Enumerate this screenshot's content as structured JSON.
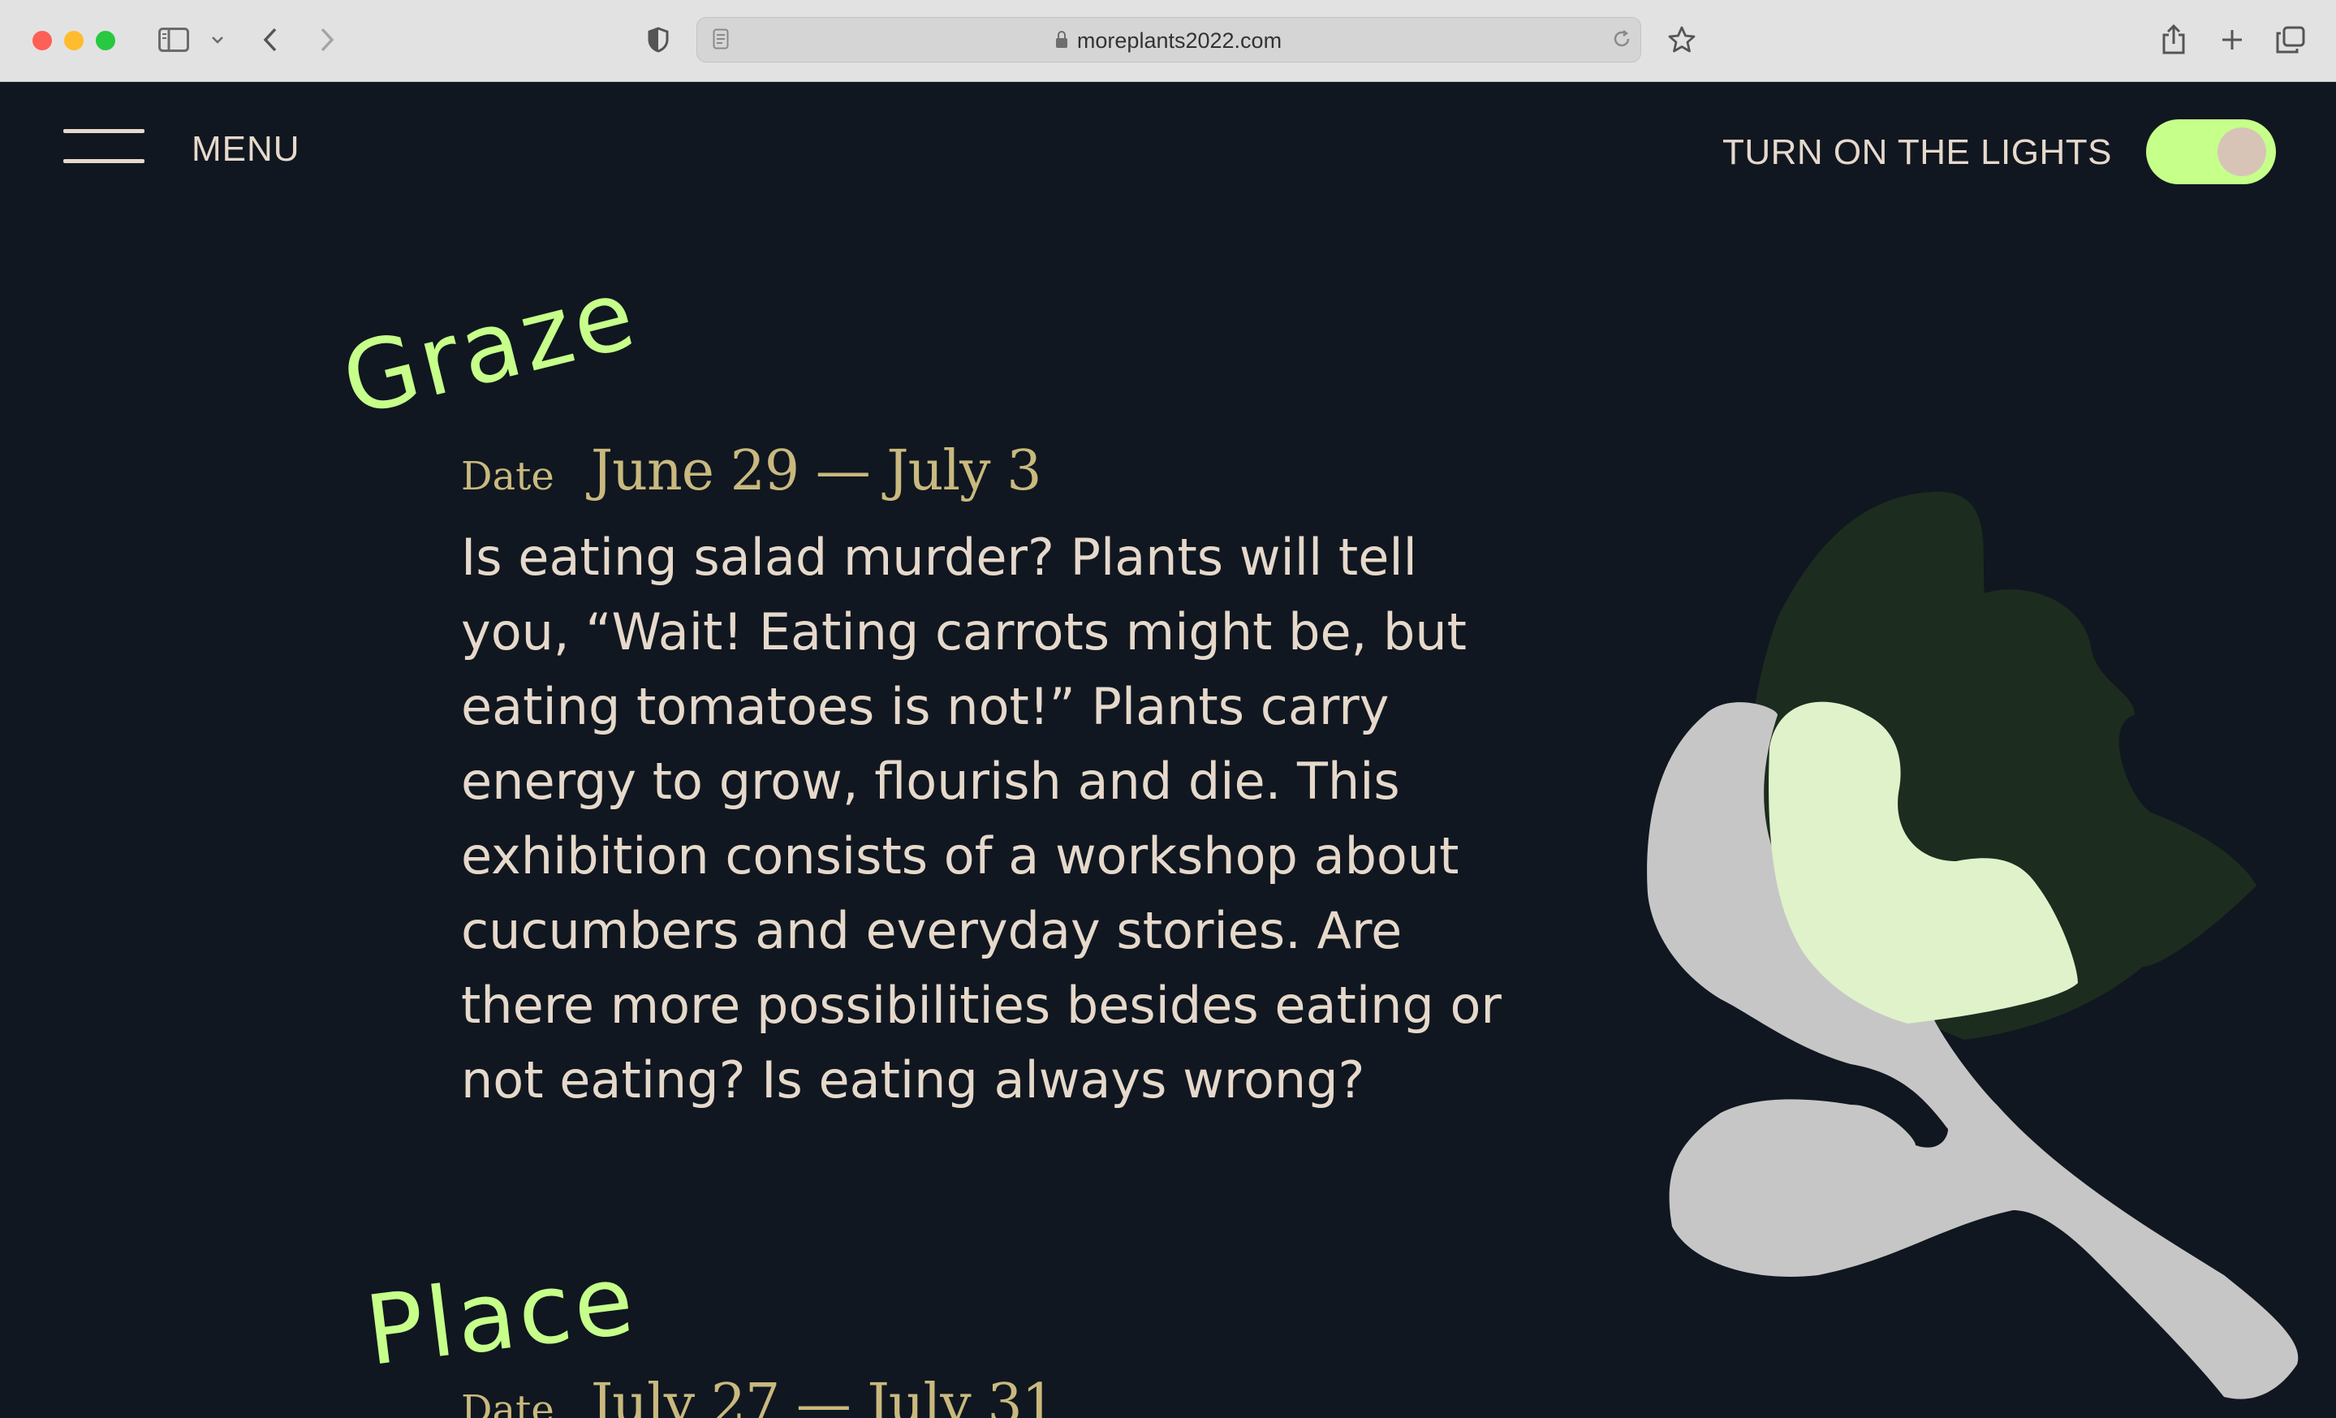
{
  "browser": {
    "url": "moreplants2022.com"
  },
  "header": {
    "menu_label": "MENU",
    "lights_label": "TURN ON THE LIGHTS",
    "lights_toggle_on": true
  },
  "colors": {
    "background": "#101720",
    "accent": "#c6ff8a",
    "text": "#e6d9cb",
    "date_text": "#c9b97e"
  },
  "events": [
    {
      "title": "Graze",
      "date_label": "Date",
      "date_value": "June 29 — July 3",
      "description": "Is eating salad murder? Plants will tell you, “Wait! Eating carrots might be, but eating tomatoes is not!” Plants carry energy to grow, flourish and die. This exhibition consists of a workshop about cucumbers and everyday stories. Are there more possibilities besides eating or not eating? Is eating always wrong?"
    },
    {
      "title": "Place",
      "date_label": "Date",
      "date_value": "July 27 — July 31"
    }
  ]
}
